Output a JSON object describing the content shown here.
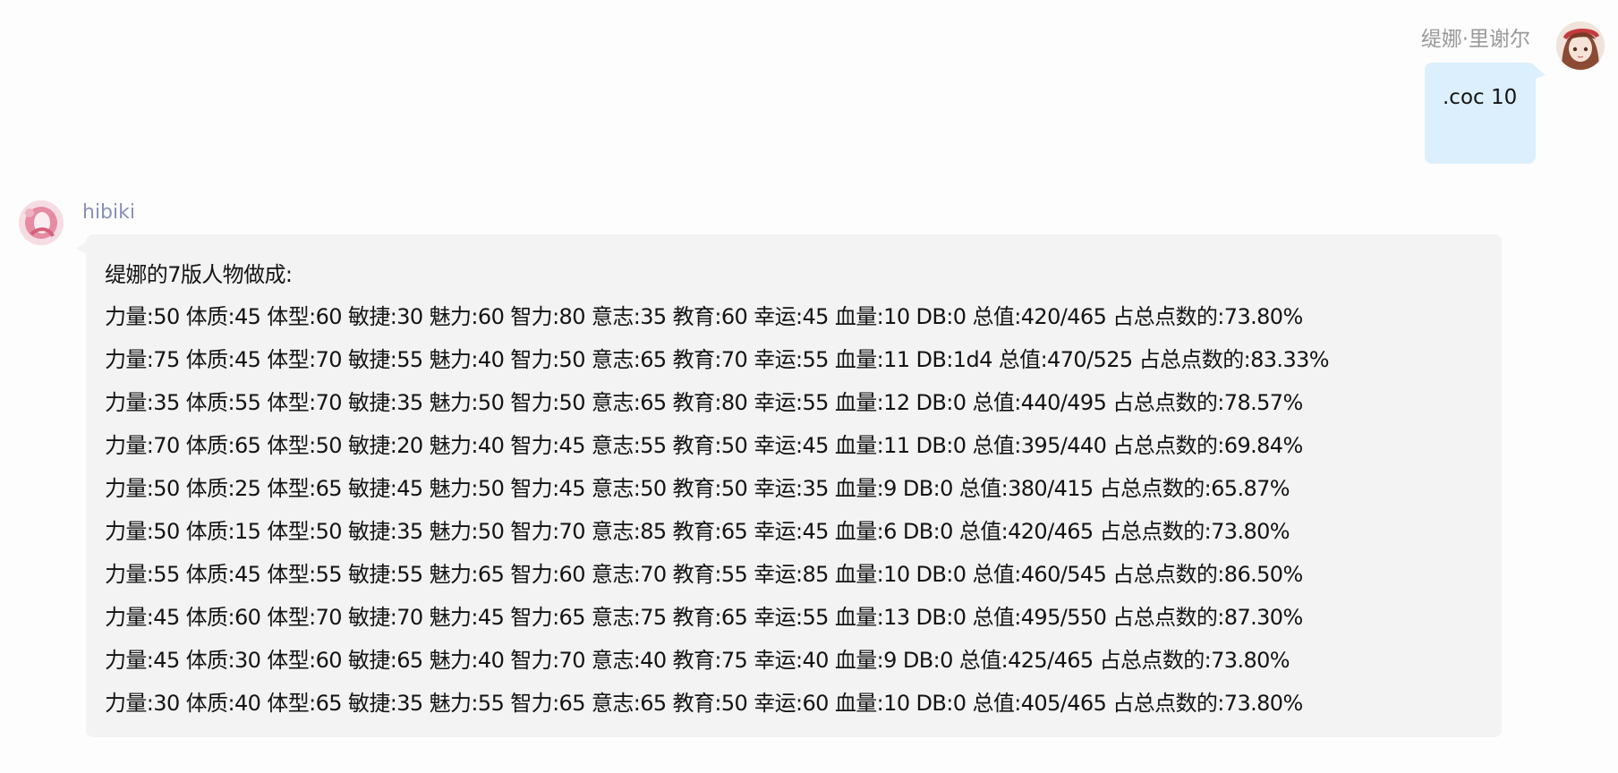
{
  "outgoing": {
    "sender": "缇娜·里谢尔",
    "text": ".coc 10"
  },
  "incoming": {
    "sender": "hibiki",
    "header": "缇娜的7版人物做成:",
    "rows": [
      "力量:50 体质:45 体型:60 敏捷:30 魅力:60 智力:80 意志:35 教育:60 幸运:45 血量:10 DB:0 总值:420/465 占总点数的:73.80%",
      "力量:75 体质:45 体型:70 敏捷:55 魅力:40 智力:50 意志:65 教育:70 幸运:55 血量:11 DB:1d4 总值:470/525 占总点数的:83.33%",
      "力量:35 体质:55 体型:70 敏捷:35 魅力:50 智力:50 意志:65 教育:80 幸运:55 血量:12 DB:0 总值:440/495 占总点数的:78.57%",
      "力量:70 体质:65 体型:50 敏捷:20 魅力:40 智力:45 意志:55 教育:50 幸运:45 血量:11 DB:0 总值:395/440 占总点数的:69.84%",
      "力量:50 体质:25 体型:65 敏捷:45 魅力:50 智力:45 意志:50 教育:50 幸运:35 血量:9 DB:0 总值:380/415 占总点数的:65.87%",
      "力量:50 体质:15 体型:50 敏捷:35 魅力:50 智力:70 意志:85 教育:65 幸运:45 血量:6 DB:0 总值:420/465 占总点数的:73.80%",
      "力量:55 体质:45 体型:55 敏捷:55 魅力:65 智力:60 意志:70 教育:55 幸运:85 血量:10 DB:0 总值:460/545 占总点数的:86.50%",
      "力量:45 体质:60 体型:70 敏捷:70 魅力:45 智力:65 意志:75 教育:65 幸运:55 血量:13 DB:0 总值:495/550 占总点数的:87.30%",
      "力量:45 体质:30 体型:60 敏捷:65 魅力:40 智力:70 意志:40 教育:75 幸运:40 血量:9 DB:0 总值:425/465 占总点数的:73.80%",
      "力量:30 体质:40 体型:65 敏捷:35 魅力:55 智力:65 意志:65 教育:50 幸运:60 血量:10 DB:0 总值:405/465 占总点数的:73.80%"
    ]
  },
  "colors": {
    "background": "#fdfdfd",
    "outgoing_bubble": "#dceffc",
    "incoming_bubble": "#f3f3f3",
    "outgoing_name": "#9a9a9a",
    "incoming_name": "#8a90b8"
  },
  "icons": {
    "outgoing_avatar": "user-avatar-anime-girl",
    "incoming_avatar": "user-avatar-pink-abstract"
  }
}
